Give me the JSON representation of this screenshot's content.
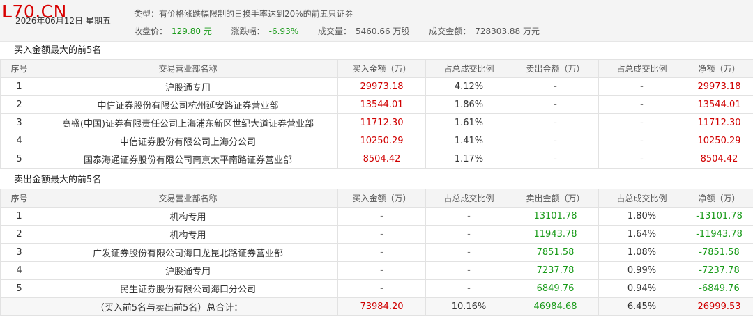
{
  "header": {
    "logo": "L70.CN",
    "date": "2026年06月12日 星期五",
    "type": "类型：有价格涨跌幅限制的日换手率达到20%的前五只证券",
    "close_label": "收盘价：",
    "close_value": "129.80 元",
    "change_label": "涨跌幅：",
    "change_value": "-6.93%",
    "volume_label": "成交量：",
    "volume_value": "5460.66 万股",
    "amount_label": "成交金额：",
    "amount_value": "728303.88 万元"
  },
  "buy_section": {
    "title": "买入金额最大的前5名",
    "columns": [
      "序号",
      "交易营业部名称",
      "买入金额（万）",
      "占总成交比例",
      "卖出金额（万）",
      "占总成交比例",
      "净额（万）"
    ],
    "rows": [
      {
        "no": "1",
        "name": "沪股通专用",
        "buy": "29973.18",
        "buy_pct": "4.12%",
        "sell": "-",
        "sell_pct": "-",
        "net": "29973.18"
      },
      {
        "no": "2",
        "name": "中信证券股份有限公司杭州延安路证券营业部",
        "buy": "13544.01",
        "buy_pct": "1.86%",
        "sell": "-",
        "sell_pct": "-",
        "net": "13544.01"
      },
      {
        "no": "3",
        "name": "高盛(中国)证券有限责任公司上海浦东新区世纪大道证券营业部",
        "buy": "11712.30",
        "buy_pct": "1.61%",
        "sell": "-",
        "sell_pct": "-",
        "net": "11712.30"
      },
      {
        "no": "4",
        "name": "中信证券股份有限公司上海分公司",
        "buy": "10250.29",
        "buy_pct": "1.41%",
        "sell": "-",
        "sell_pct": "-",
        "net": "10250.29"
      },
      {
        "no": "5",
        "name": "国泰海通证券股份有限公司南京太平南路证券营业部",
        "buy": "8504.42",
        "buy_pct": "1.17%",
        "sell": "-",
        "sell_pct": "-",
        "net": "8504.42"
      }
    ]
  },
  "sell_section": {
    "title": "卖出金额最大的前5名",
    "columns": [
      "序号",
      "交易营业部名称",
      "买入金额（万）",
      "占总成交比例",
      "卖出金额（万）",
      "占总成交比例",
      "净额（万）"
    ],
    "rows": [
      {
        "no": "1",
        "name": "机构专用",
        "buy": "-",
        "buy_pct": "-",
        "sell": "13101.78",
        "sell_pct": "1.80%",
        "net": "-13101.78"
      },
      {
        "no": "2",
        "name": "机构专用",
        "buy": "-",
        "buy_pct": "-",
        "sell": "11943.78",
        "sell_pct": "1.64%",
        "net": "-11943.78"
      },
      {
        "no": "3",
        "name": "广发证券股份有限公司海口龙昆北路证券营业部",
        "buy": "-",
        "buy_pct": "-",
        "sell": "7851.58",
        "sell_pct": "1.08%",
        "net": "-7851.58"
      },
      {
        "no": "4",
        "name": "沪股通专用",
        "buy": "-",
        "buy_pct": "-",
        "sell": "7237.78",
        "sell_pct": "0.99%",
        "net": "-7237.78"
      },
      {
        "no": "5",
        "name": "民生证券股份有限公司海口分公司",
        "buy": "-",
        "buy_pct": "-",
        "sell": "6849.76",
        "sell_pct": "0.94%",
        "net": "-6849.76"
      }
    ],
    "total": {
      "label": "（买入前5名与卖出前5名）总合计：",
      "buy": "73984.20",
      "buy_pct": "10.16%",
      "sell": "46984.68",
      "sell_pct": "6.45%",
      "net": "26999.53"
    }
  },
  "colors": {
    "up": "#d00000",
    "down": "#1a9b1a",
    "header_bg": "#f4f4f4"
  }
}
